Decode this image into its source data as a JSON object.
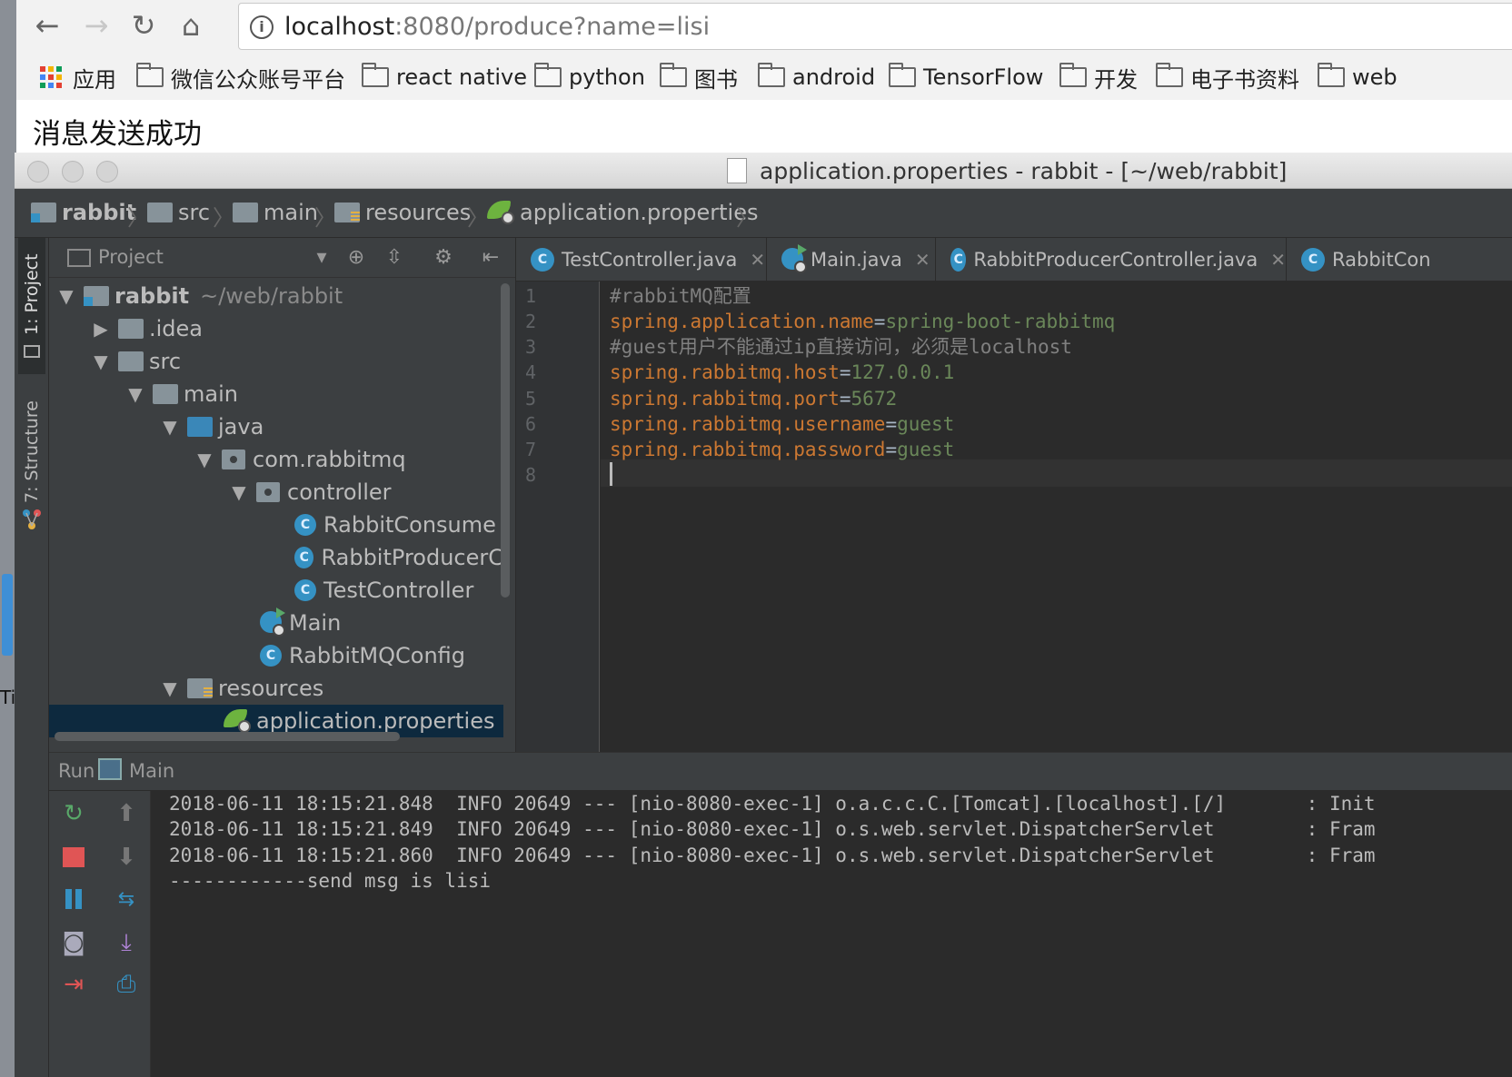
{
  "browser": {
    "nav": {
      "back_icon": "arrow-left-icon",
      "forward_icon": "arrow-right-icon",
      "reload_icon": "reload-icon",
      "home_icon": "home-icon"
    },
    "url": {
      "host": "localhost",
      "rest": ":8080/produce?name=lisi"
    },
    "bookmarks": [
      {
        "label": "应用",
        "type": "apps"
      },
      {
        "label": "微信公众账号平台",
        "type": "folder"
      },
      {
        "label": "react native",
        "type": "folder"
      },
      {
        "label": "python",
        "type": "folder"
      },
      {
        "label": "图书",
        "type": "folder"
      },
      {
        "label": "android",
        "type": "folder"
      },
      {
        "label": "TensorFlow",
        "type": "folder"
      },
      {
        "label": "开发",
        "type": "folder"
      },
      {
        "label": "电子书资料",
        "type": "folder"
      },
      {
        "label": "web",
        "type": "folder"
      }
    ],
    "page_text": "消息发送成功",
    "side_label": "Ti"
  },
  "ide": {
    "window_title": "application.properties - rabbit - [~/web/rabbit]",
    "breadcrumbs": [
      "rabbit",
      "src",
      "main",
      "resources",
      "application.properties"
    ],
    "tool_tabs": [
      "1: Project",
      "7: Structure"
    ],
    "project_panel": {
      "title": "Project",
      "tree": [
        {
          "label": "rabbit",
          "extra": "~/web/rabbit",
          "depth": 0,
          "arrow": "down",
          "icon": "module"
        },
        {
          "label": ".idea",
          "depth": 1,
          "arrow": "right",
          "icon": "folder"
        },
        {
          "label": "src",
          "depth": 1,
          "arrow": "down",
          "icon": "folder"
        },
        {
          "label": "main",
          "depth": 2,
          "arrow": "down",
          "icon": "folder"
        },
        {
          "label": "java",
          "depth": 3,
          "arrow": "down",
          "icon": "source-folder"
        },
        {
          "label": "com.rabbitmq",
          "depth": 4,
          "arrow": "down",
          "icon": "package"
        },
        {
          "label": "controller",
          "depth": 5,
          "arrow": "down",
          "icon": "package"
        },
        {
          "label": "RabbitConsume",
          "depth": 6,
          "arrow": "",
          "icon": "class"
        },
        {
          "label": "RabbitProducerC",
          "depth": 6,
          "arrow": "",
          "icon": "class"
        },
        {
          "label": "TestController",
          "depth": 6,
          "arrow": "",
          "icon": "class"
        },
        {
          "label": "Main",
          "depth": 5,
          "arrow": "",
          "icon": "main-class"
        },
        {
          "label": "RabbitMQConfig",
          "depth": 5,
          "arrow": "",
          "icon": "class"
        },
        {
          "label": "resources",
          "depth": 3,
          "arrow": "down",
          "icon": "resource-folder"
        },
        {
          "label": "application.properties",
          "depth": 4,
          "arrow": "",
          "icon": "spring",
          "selected": true
        }
      ]
    },
    "editor": {
      "tabs": [
        {
          "label": "TestController.java",
          "icon": "class"
        },
        {
          "label": "Main.java",
          "icon": "main-class"
        },
        {
          "label": "RabbitProducerController.java",
          "icon": "class"
        },
        {
          "label": "RabbitCon",
          "icon": "class"
        }
      ],
      "lines": [
        {
          "num": "1",
          "parts": [
            {
              "t": "#rabbitMQ配置",
              "c": "c"
            }
          ]
        },
        {
          "num": "2",
          "parts": [
            {
              "t": "spring.application.name",
              "c": "k"
            },
            {
              "t": "=",
              "c": "e"
            },
            {
              "t": "spring-boot-rabbitmq",
              "c": "v"
            }
          ]
        },
        {
          "num": "3",
          "parts": [
            {
              "t": "#guest用户不能通过ip直接访问，必须是localhost",
              "c": "c"
            }
          ]
        },
        {
          "num": "4",
          "parts": [
            {
              "t": "spring.rabbitmq.host",
              "c": "k"
            },
            {
              "t": "=",
              "c": "e"
            },
            {
              "t": "127.0.0.1",
              "c": "v"
            }
          ]
        },
        {
          "num": "5",
          "parts": [
            {
              "t": "spring.rabbitmq.port",
              "c": "k"
            },
            {
              "t": "=",
              "c": "e"
            },
            {
              "t": "5672",
              "c": "v"
            }
          ]
        },
        {
          "num": "6",
          "parts": [
            {
              "t": "spring.rabbitmq.username",
              "c": "k"
            },
            {
              "t": "=",
              "c": "e"
            },
            {
              "t": "guest",
              "c": "v"
            }
          ]
        },
        {
          "num": "7",
          "parts": [
            {
              "t": "spring.rabbitmq.password",
              "c": "k"
            },
            {
              "t": "=",
              "c": "e"
            },
            {
              "t": "guest",
              "c": "v"
            }
          ]
        },
        {
          "num": "8",
          "parts": []
        }
      ]
    },
    "run_panel": {
      "title": "Run",
      "config": "Main",
      "console": [
        "2018-06-11 18:15:21.848  INFO 20649 --- [nio-8080-exec-1] o.a.c.c.C.[Tomcat].[localhost].[/]       : Init",
        "2018-06-11 18:15:21.849  INFO 20649 --- [nio-8080-exec-1] o.s.web.servlet.DispatcherServlet        : Fram",
        "2018-06-11 18:15:21.860  INFO 20649 --- [nio-8080-exec-1] o.s.web.servlet.DispatcherServlet        : Fram",
        "------------send msg is lisi"
      ]
    }
  },
  "colors": {
    "keyword": "#cc7832",
    "value": "#6a8759",
    "comment": "#808080",
    "equals": "#a9b7c6",
    "selection": "#0d293e",
    "class_icon": "#3592c4",
    "rerun": "#59a869",
    "stop": "#e05555"
  }
}
